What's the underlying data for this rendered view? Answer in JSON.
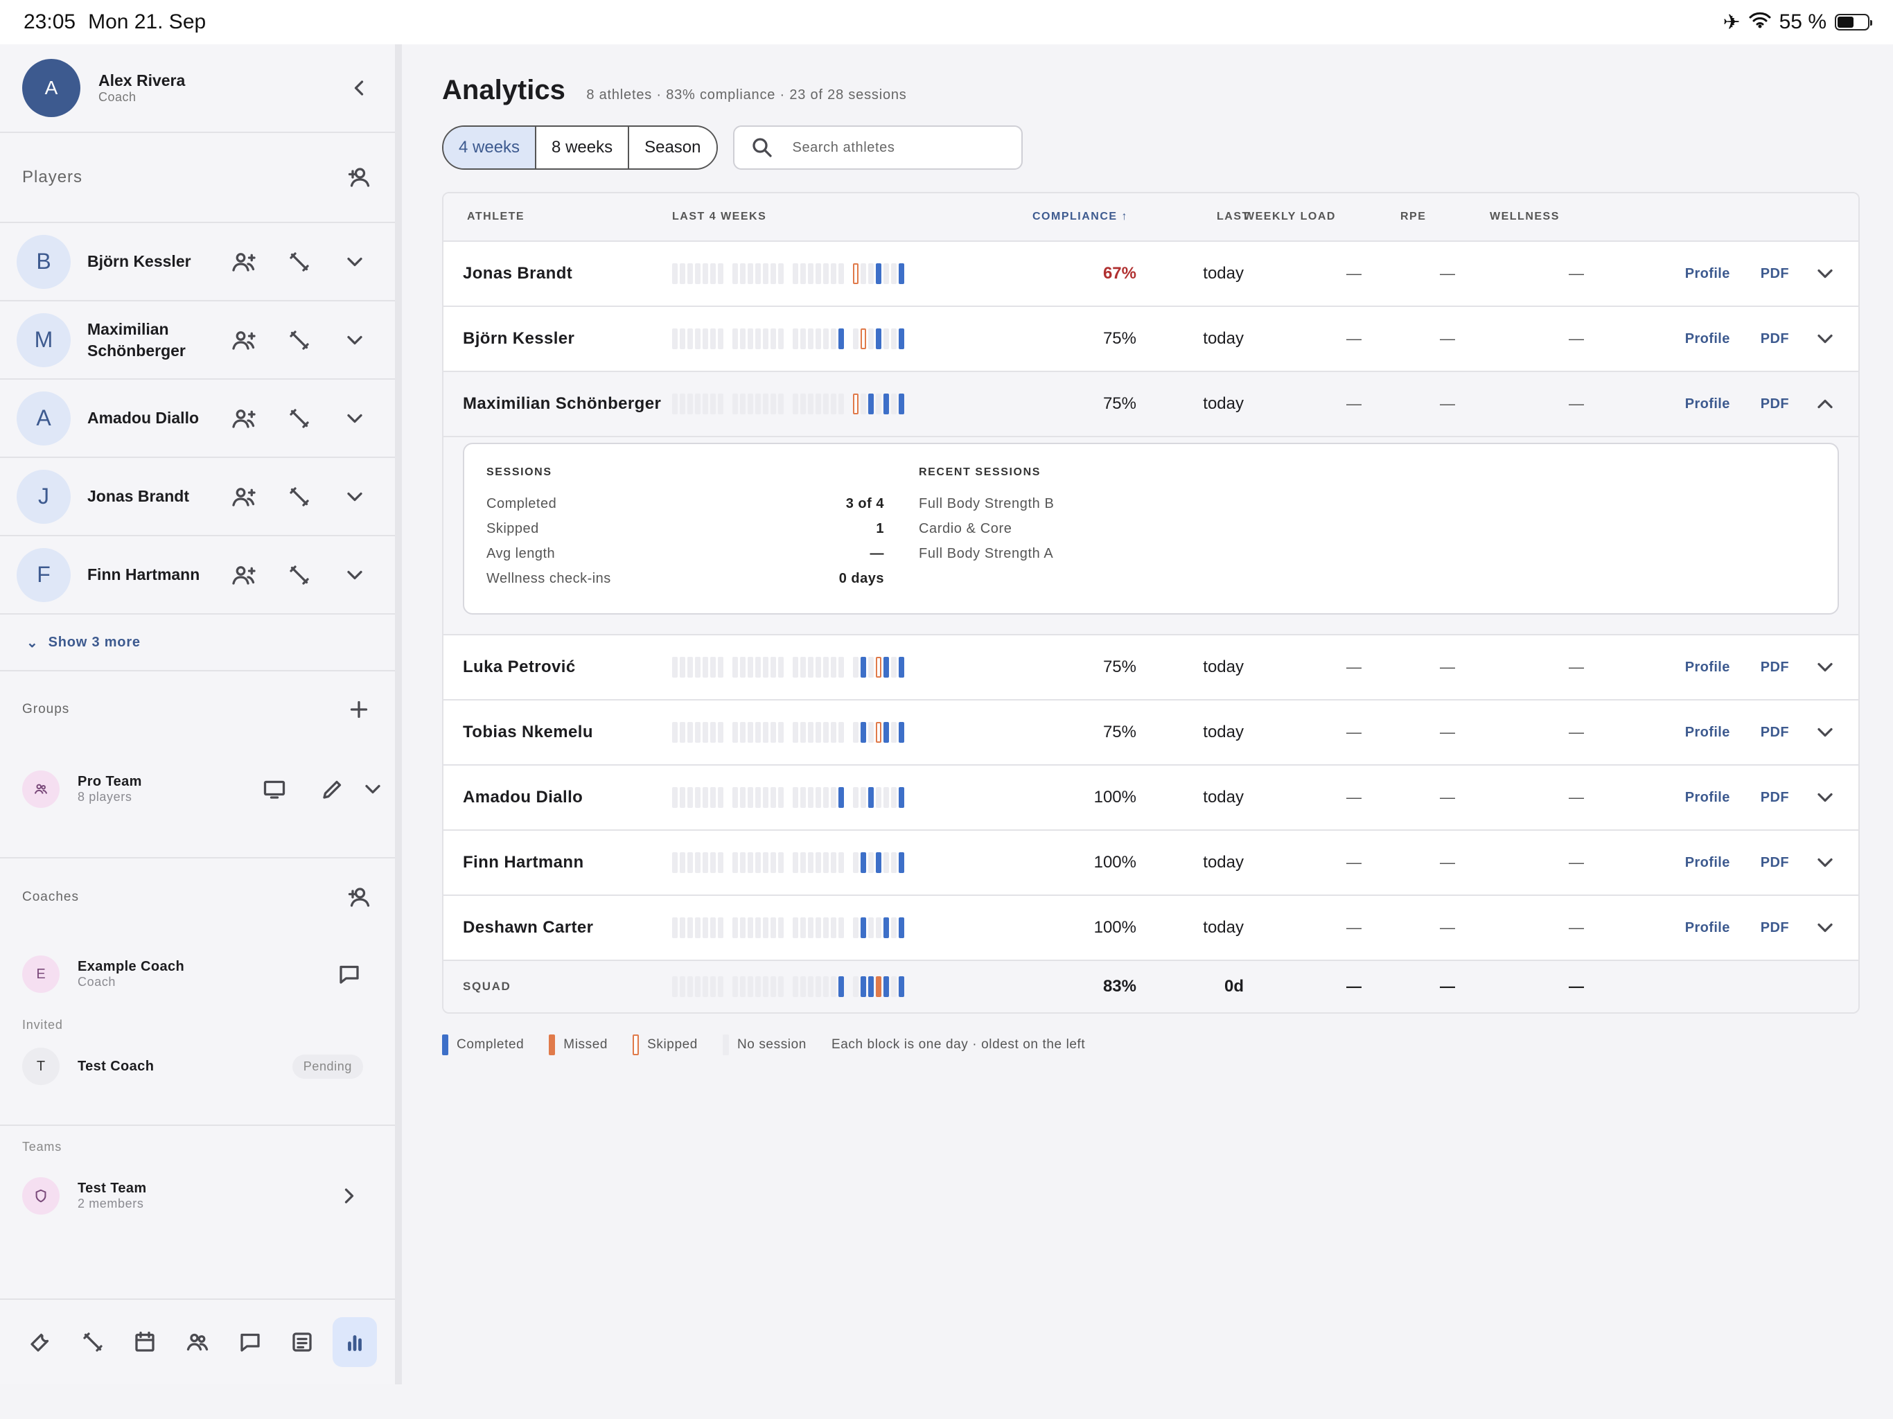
{
  "status": {
    "time": "23:05",
    "date": "Mon 21. Sep",
    "battery": "55 %",
    "battery_level": 0.55
  },
  "sidebar": {
    "user": {
      "initial": "A",
      "name": "Alex Rivera",
      "role": "Coach"
    },
    "players_label": "Players",
    "players": [
      {
        "initial": "B",
        "name": "Björn Kessler"
      },
      {
        "initial": "M",
        "name": "Maximilian Schönberger"
      },
      {
        "initial": "A",
        "name": "Amadou Diallo"
      },
      {
        "initial": "J",
        "name": "Jonas Brandt"
      },
      {
        "initial": "F",
        "name": "Finn Hartmann"
      }
    ],
    "show_more": "Show 3 more",
    "groups_label": "Groups",
    "group": {
      "name": "Pro Team",
      "meta": "8 players"
    },
    "coaches_label": "Coaches",
    "coach": {
      "initial": "E",
      "name": "Example Coach",
      "role": "Coach"
    },
    "invited_label": "Invited",
    "invited": {
      "initial": "T",
      "name": "Test Coach",
      "badge": "Pending"
    },
    "teams_label": "Teams",
    "team": {
      "name": "Test Team",
      "meta": "2 members"
    }
  },
  "main": {
    "title": "Analytics",
    "subtitle": "8 athletes · 83% compliance · 23 of 28 sessions",
    "ranges": [
      "4 weeks",
      "8 weeks",
      "Season"
    ],
    "search_placeholder": "Search athletes",
    "columns": {
      "athlete": "ATHLETE",
      "last4": "LAST 4 WEEKS",
      "compliance": "COMPLIANCE ↑",
      "last": "LAST",
      "weekly_load": "WEEKLY LOAD",
      "rpe": "RPE",
      "wellness": "WELLNESS"
    },
    "rows": [
      {
        "name": "Jonas Brandt",
        "days": "nnnnnnn|nnnnnnn|nnnnnnn|snncnnc",
        "compliance": "67%",
        "last": "today",
        "load": "—",
        "rpe": "—",
        "wellness": "—"
      },
      {
        "name": "Björn Kessler",
        "days": "nnnnnnn|nnnnnnn|nnnnnnc|nsncnnc",
        "compliance": "75%",
        "last": "today",
        "load": "—",
        "rpe": "—",
        "wellness": "—"
      },
      {
        "name": "Maximilian Schönberger",
        "days": "nnnnnnn|nnnnnnn|nnnnnnn|sncncnc",
        "compliance": "75%",
        "last": "today",
        "load": "—",
        "rpe": "—",
        "wellness": "—",
        "open": true
      },
      {
        "name": "Luka Petrović",
        "days": "nnnnnnn|nnnnnnn|nnnnnnn|ncnscnc",
        "compliance": "75%",
        "last": "today",
        "load": "—",
        "rpe": "—",
        "wellness": "—"
      },
      {
        "name": "Tobias Nkemelu",
        "days": "nnnnnnn|nnnnnnn|nnnnnnn|ncnscnc",
        "compliance": "75%",
        "last": "today",
        "load": "—",
        "rpe": "—",
        "wellness": "—"
      },
      {
        "name": "Amadou Diallo",
        "days": "nnnnnnn|nnnnnnn|nnnnnnc|nncnnnc",
        "compliance": "100%",
        "last": "today",
        "load": "—",
        "rpe": "—",
        "wellness": "—"
      },
      {
        "name": "Finn Hartmann",
        "days": "nnnnnnn|nnnnnnn|nnnnnnn|ncncnnc",
        "compliance": "100%",
        "last": "today",
        "load": "—",
        "rpe": "—",
        "wellness": "—"
      },
      {
        "name": "Deshawn Carter",
        "days": "nnnnnnn|nnnnnnn|nnnnnnn|ncnncnc",
        "compliance": "100%",
        "last": "today",
        "load": "—",
        "rpe": "—",
        "wellness": "—"
      }
    ],
    "profile": "Profile",
    "pdf": "PDF",
    "detail": {
      "sessions_title": "SESSIONS",
      "stats": [
        {
          "k": "Completed",
          "v": "3 of 4"
        },
        {
          "k": "Skipped",
          "v": "1"
        },
        {
          "k": "Avg length",
          "v": "—"
        },
        {
          "k": "Wellness check-ins",
          "v": "0 days"
        }
      ],
      "recent_title": "RECENT SESSIONS",
      "recent": [
        "Full Body Strength B",
        "Cardio & Core",
        "Full Body Strength A"
      ]
    },
    "squad": {
      "label": "SQUAD",
      "days": "nnnnnnn|nnnnnnn|nnnnnnc|nccmcnc",
      "compliance": "83%",
      "last": "0d",
      "load": "—",
      "rpe": "—",
      "wellness": "—"
    },
    "legend": {
      "completed": "Completed",
      "missed": "Missed",
      "skipped": "Skipped",
      "none": "No session",
      "note": "Each block is one day · oldest on the left"
    }
  },
  "colors": {
    "completed": "#3d6fc8",
    "missed": "#e07a4a",
    "none": "#ececf0",
    "accent": "#3d5a8f",
    "warn": "#b03030"
  }
}
